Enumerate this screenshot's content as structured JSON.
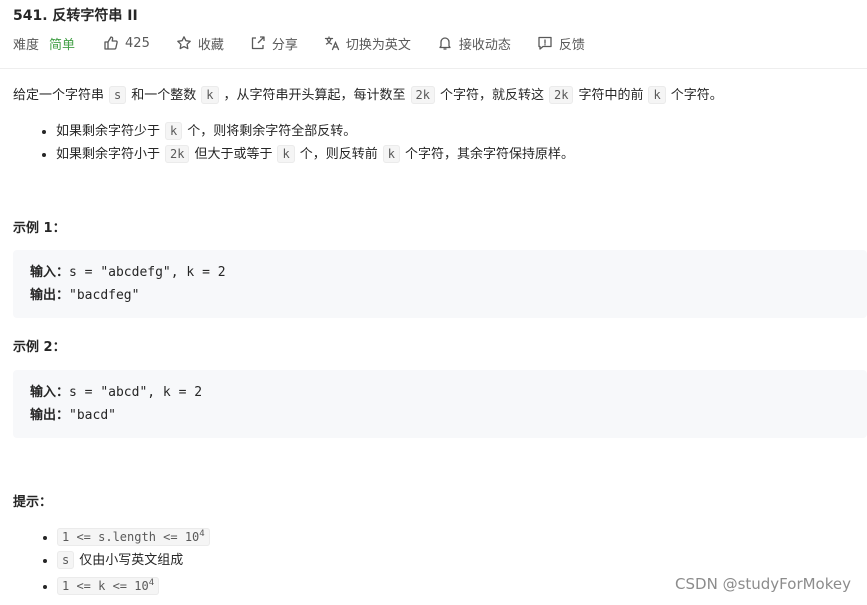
{
  "problem": {
    "title": "541. 反转字符串 II"
  },
  "meta": {
    "difficulty_label": "难度",
    "difficulty_value": "简单",
    "likes": "425",
    "favorite": "收藏",
    "share": "分享",
    "translate": "切换为英文",
    "notify": "接收动态",
    "feedback": "反馈"
  },
  "description": {
    "p1": "给定一个字符串",
    "c_s": "s",
    "p2": "和一个整数",
    "c_k": "k",
    "p3": "，从字符串开头算起，每计数至",
    "c_2k": "2k",
    "p4": "个字符，就反转这",
    "p5": "字符中的前",
    "p6": "个字符。"
  },
  "rules": {
    "r1_a": "如果剩余字符少于",
    "r1_b": "个，则将剩余字符全部反转。",
    "r2_a": "如果剩余字符小于",
    "r2_b": "但大于或等于",
    "r2_c": "个，则反转前",
    "r2_d": "个字符，其余字符保持原样。"
  },
  "examples": [
    {
      "heading": "示例 1：",
      "input_label": "输入：",
      "input": "s = \"abcdefg\", k = 2",
      "output_label": "输出：",
      "output": "\"bacdfeg\""
    },
    {
      "heading": "示例 2：",
      "input_label": "输入：",
      "input": "s = \"abcd\", k = 2",
      "output_label": "输出：",
      "output": "\"bacd\""
    }
  ],
  "hints": {
    "heading": "提示：",
    "h1": "1 <= s.length <= 10",
    "h1_sup": "4",
    "h2_code": "s",
    "h2_text": "仅由小写英文组成",
    "h3": "1 <= k <= 10",
    "h3_sup": "4"
  },
  "watermark": "CSDN @studyForMokey",
  "colors": {
    "easy": "#43a047",
    "text": "#262626",
    "code_bg": "#f7f8fa"
  }
}
